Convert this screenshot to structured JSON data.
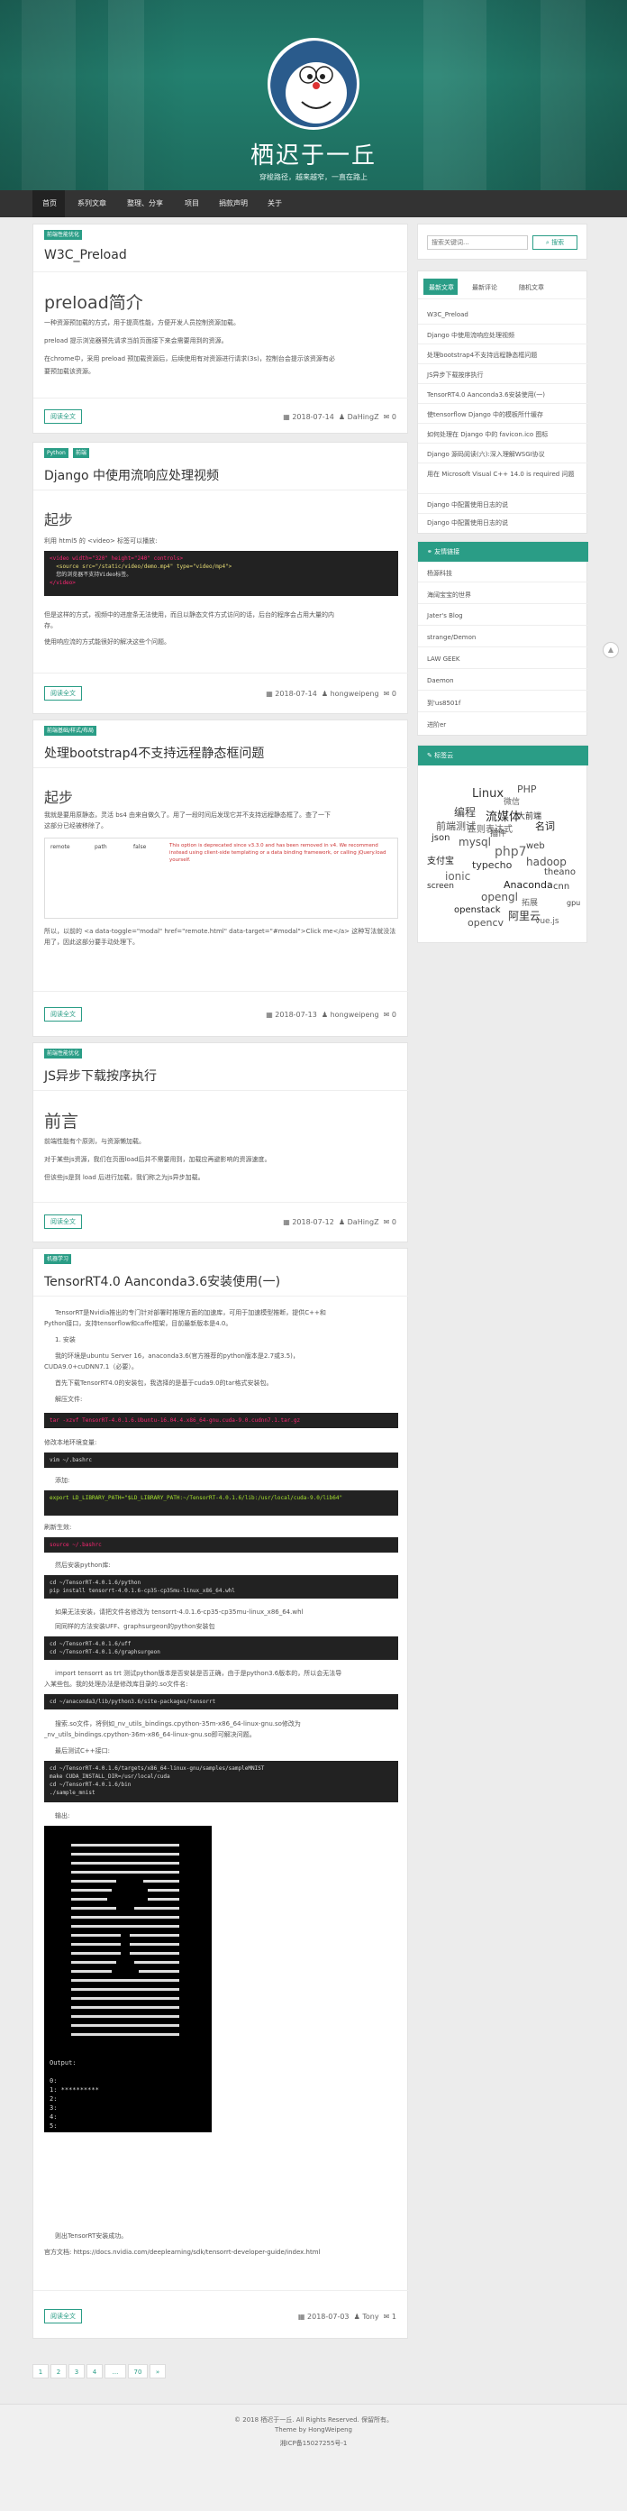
{
  "header": {
    "site_title": "栖迟于一丘",
    "site_subtitle": "穿梭路径，越来越窄，一直在路上"
  },
  "nav": [
    "首页",
    "系列文章",
    "整理、分享",
    "项目",
    "捐款声明",
    "关于"
  ],
  "posts": [
    {
      "tag": "前端性能优化",
      "title": "W3C_Preload",
      "heading": "preload简介",
      "lines": [
        "一种资源预加载的方式，用于提高性能，方便开发人员控制资源加载。",
        "preload 提示浏览器预先请求当前页面接下来会需要用到的资源。",
        "在chrome中，采用 preload 预加载资源后，后续使用有对资源进行请求(3s)，控制台会提示该资源有必",
        "要预加载该资源。"
      ],
      "read_more": "阅读全文",
      "date": "2018-07-14",
      "author": "DaHingZ",
      "comments": "0"
    },
    {
      "tags": [
        "Python",
        "前端"
      ],
      "title": "Django 中使用流响应处理视频",
      "heading": "起步",
      "intro": "利用 html5 的 <video> 标签可以播放:",
      "code": [
        "<video width=\"320\" height=\"240\" controls>",
        "  <source src=\"/static/video/demo.mp4\" type=\"video/mp4\">",
        "  您的浏览器不支持Video标签。",
        "</video>"
      ],
      "lines": [
        "但是这样的方式，视频中的进度条无法使用，而且以静态文件方式访问的话，后台的程序会占用大量的内",
        "存。",
        "使用响应流的方式能很好的解决这些个问题。"
      ],
      "read_more": "阅读全文",
      "date": "2018-07-14",
      "author": "hongweipeng",
      "comments": "0"
    },
    {
      "tag": "前端基础/样式/布局",
      "title": "处理bootstrap4不支持远程静态框问题",
      "heading": "起步",
      "lines": [
        "我就是要用原静态，灵活 bs4 由来自做久了。用了一段时间后发现它并不支持远程静态框了。查了一下",
        "这部分已经被移除了。"
      ],
      "table_cols": [
        "remote",
        "path",
        "false"
      ],
      "warning": "This option is deprecated since v3.3.0 and has been removed in v4. We recommend instead using client-side templating or a data binding framework, or calling jQuery.load yourself.",
      "after": "所以，以前的 <a data-toggle=\"modal\" href=\"remote.html\" data-target=\"#modal\">Click me</a> 这种写法就没法用了，因此这部分要手动处理下。",
      "read_more": "阅读全文",
      "date": "2018-07-13",
      "author": "hongweipeng",
      "comments": "0"
    },
    {
      "tag": "前端性能优化",
      "title": "JS异步下载按序执行",
      "heading": "前言",
      "lines": [
        "前端性能有个原则，与资源懒加载。",
        "对于某些js资源，我们在页面load后并不需要用到，加载应再避影响的资源速度。",
        "但该些js是到 load 后进行加载，我们称之为js异步加载。"
      ],
      "read_more": "阅读全文",
      "date": "2018-07-12",
      "author": "DaHingZ",
      "comments": "0"
    },
    {
      "tag": "机器学习",
      "title": "TensorRT4.0 Aanconda3.6安装使用(一)",
      "lines": [
        "TensorRT是Nvidia推出的专门针对部署时推理方面的加速库，可用于加速模型推断，提供C++和",
        "Python接口，支持tensorflow和caffe框架，目前最新版本是4.0。",
        "1. 安装",
        "我的环境是ubuntu Server 16，anaconda3.6(官方推荐的python版本是2.7或3.5)，",
        "CUDA9.0+cuDNN7.1（必要）。",
        "首先下载TensorRT4.0的安装包，我选择的是基于cuda9.0的tar格式安装包。",
        "解压文件:"
      ],
      "code_tar": "tar -xzvf TensorRT-4.0.1.6.Ubuntu-16.04.4.x86_64-gnu.cuda-9.0.cudnn7.1.tar.gz",
      "edit_env": "修改本地环境变量:",
      "code_vim": "vim ~/.bashrc",
      "add": "添加:",
      "code_export": "export LD_LIBRARY_PATH=\"$LD_LIBRARY_PATH:~/TensorRT-4.0.1.6/lib:/usr/local/cuda-9.0/lib64\"",
      "refresh": "刷新生效:",
      "code_source": "source ~/.bashrc",
      "install_py": "然后安装python库:",
      "code_pip": [
        "cd ~/TensorRT-4.0.1.6/python",
        "pip install tensorrt-4.0.1.6-cp35-cp35mu-linux_x86_64.whl"
      ],
      "note1": "如果无法安装，请把文件名修改为 tensorrt-4.0.1.6-cp35-cp35mu-linux_x86_64.whl",
      "note2": "同同样的方法安装UFF、graphsurgeon的python安装包",
      "code_uff": [
        "cd ~/TensorRT-4.0.1.6/uff",
        "cd ~/TensorRT-4.0.1.6/graphsurgeon"
      ],
      "note3": "import tensorrt as trt 测试python版本是否安装是否正确，由于是python3.6版本的，所以会无法导",
      "note4": "入某些包。我的处理办法是修改库目录的.so文件名:",
      "code_cd": "cd ~/anaconda3/lib/python3.6/site-packages/tensorrt",
      "note5": "搜索.so文件，将例如_nv_utils_bindings.cpython-35m-x86_64-linux-gnu.so修改为",
      "note6": "_nv_utils_bindings.cpython-36m-x86_64-linux-gnu.so即可解决问题。",
      "note7": "最后测试C++接口:",
      "code_cpp": [
        "cd ~/TensorRT-4.0.1.6/targets/x86_64-linux-gnu/samples/sampleMNIST",
        "make CUDA_INSTALL_DIR=/usr/local/cuda",
        "cd ~/TensorRT-4.0.1.6/bin",
        "./sample_mnist"
      ],
      "output_label": "输出:",
      "terminal_output": [
        "Output:",
        "",
        "0:",
        "1: **********",
        "2:",
        "3:",
        "4:",
        "5:"
      ],
      "done": "则出TensorRT安装成功。",
      "doc": "官方文档: https://docs.nvidia.com/deeplearning/sdk/tensorrt-developer-guide/index.html",
      "read_more": "阅读全文",
      "date": "2018-07-03",
      "author": "Tony",
      "comments": "1"
    }
  ],
  "pagination": [
    "1",
    "2",
    "3",
    "4",
    "...",
    "70",
    "»"
  ],
  "sidebar": {
    "search_placeholder": "搜索关键词...",
    "search_button": "搜索",
    "tabs": [
      "最新文章",
      "最新评论",
      "随机文章"
    ],
    "recent": [
      "W3C_Preload",
      "Django 中使用流响应处理视频",
      "处理bootstrap4不支持远程静态框问题",
      "JS异步下载按序执行",
      "TensorRT4.0 Aanconda3.6安装使用(一)",
      "使tensorflow Django 中的模板所什缓存",
      "如何处理在 Django 中的 favicon.ico 图标",
      "Django 源码阅读(六):深入理解WSGI协议",
      "用在 Microsoft Visual C++ 14.0 is required 问题",
      "Django 中配置使用日志的说",
      "Django 中配置使用日志的说"
    ],
    "links_title": "友情链接",
    "links": [
      "杨源科技",
      "海阔宝宝的世界",
      "Jater's Blog",
      "strange/Demon",
      "LAW GEEK",
      "Daemon",
      "到'us8501f",
      "进阶er"
    ],
    "tags_title": "标签云",
    "tags": [
      "Linux",
      "PHP",
      "微信",
      "编程",
      "流媒体",
      "大前端",
      "前端测试",
      "正则表达式",
      "插件",
      "名词",
      "json",
      "mysql",
      "php7",
      "web",
      "支付宝",
      "typecho",
      "hadoop",
      "ionic",
      "theano",
      "Anaconda",
      "screen",
      "opengl",
      "拓展",
      "cnn",
      "openstack",
      "阿里云",
      "opencv",
      "vue.js",
      "gpu"
    ]
  },
  "footer": {
    "copyright": "© 2018 栖迟于一丘. All Rights Reserved. 保留所有。",
    "theme": "Theme by HongWeipeng",
    "icp": "湘ICP备15027255号-1"
  }
}
